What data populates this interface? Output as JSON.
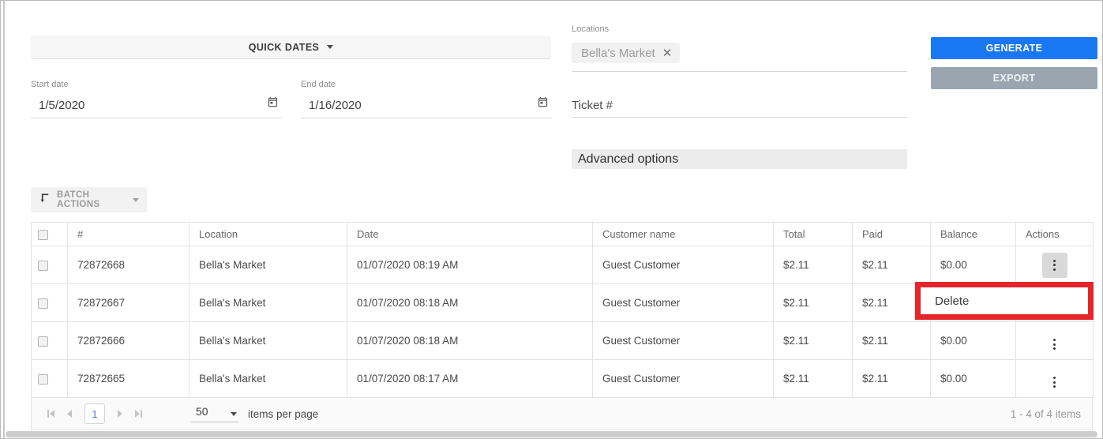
{
  "filters": {
    "quick_dates_label": "QUICK DATES",
    "start_date": {
      "label": "Start date",
      "value": "1/5/2020"
    },
    "end_date": {
      "label": "End date",
      "value": "1/16/2020"
    },
    "locations": {
      "label": "Locations",
      "chip_label": "Bella's Market"
    },
    "ticket_label": "Ticket #",
    "generate_label": "GENERATE",
    "export_label": "EXPORT",
    "advanced_options_label": "Advanced options"
  },
  "toolbar": {
    "batch_actions_label": "BATCH ACTIONS"
  },
  "table": {
    "headers": {
      "id": "#",
      "location": "Location",
      "date": "Date",
      "customer": "Customer name",
      "total": "Total",
      "paid": "Paid",
      "balance": "Balance",
      "actions": "Actions"
    },
    "rows": [
      {
        "id": "72872668",
        "location": "Bella's Market",
        "date": "01/07/2020 08:19 AM",
        "customer": "Guest Customer",
        "total": "$2.11",
        "paid": "$2.11",
        "balance": "$0.00"
      },
      {
        "id": "72872667",
        "location": "Bella's Market",
        "date": "01/07/2020 08:18 AM",
        "customer": "Guest Customer",
        "total": "$2.11",
        "paid": "$2.11"
      },
      {
        "id": "72872666",
        "location": "Bella's Market",
        "date": "01/07/2020 08:18 AM",
        "customer": "Guest Customer",
        "total": "$2.11",
        "paid": "$2.11",
        "balance": "$0.00"
      },
      {
        "id": "72872665",
        "location": "Bella's Market",
        "date": "01/07/2020 08:17 AM",
        "customer": "Guest Customer",
        "total": "$2.11",
        "paid": "$2.11",
        "balance": "$0.00"
      }
    ],
    "row_menu": {
      "delete_label": "Delete"
    }
  },
  "pagination": {
    "current_page": "1",
    "page_size": "50",
    "items_per_page_label": "items per page",
    "range_label": "1 - 4 of 4 items"
  },
  "colors": {
    "primary_blue": "#1877f2",
    "export_gray": "#9aa5af",
    "annotation_red": "#e4252a",
    "page_number_blue": "#4a7bd4"
  }
}
